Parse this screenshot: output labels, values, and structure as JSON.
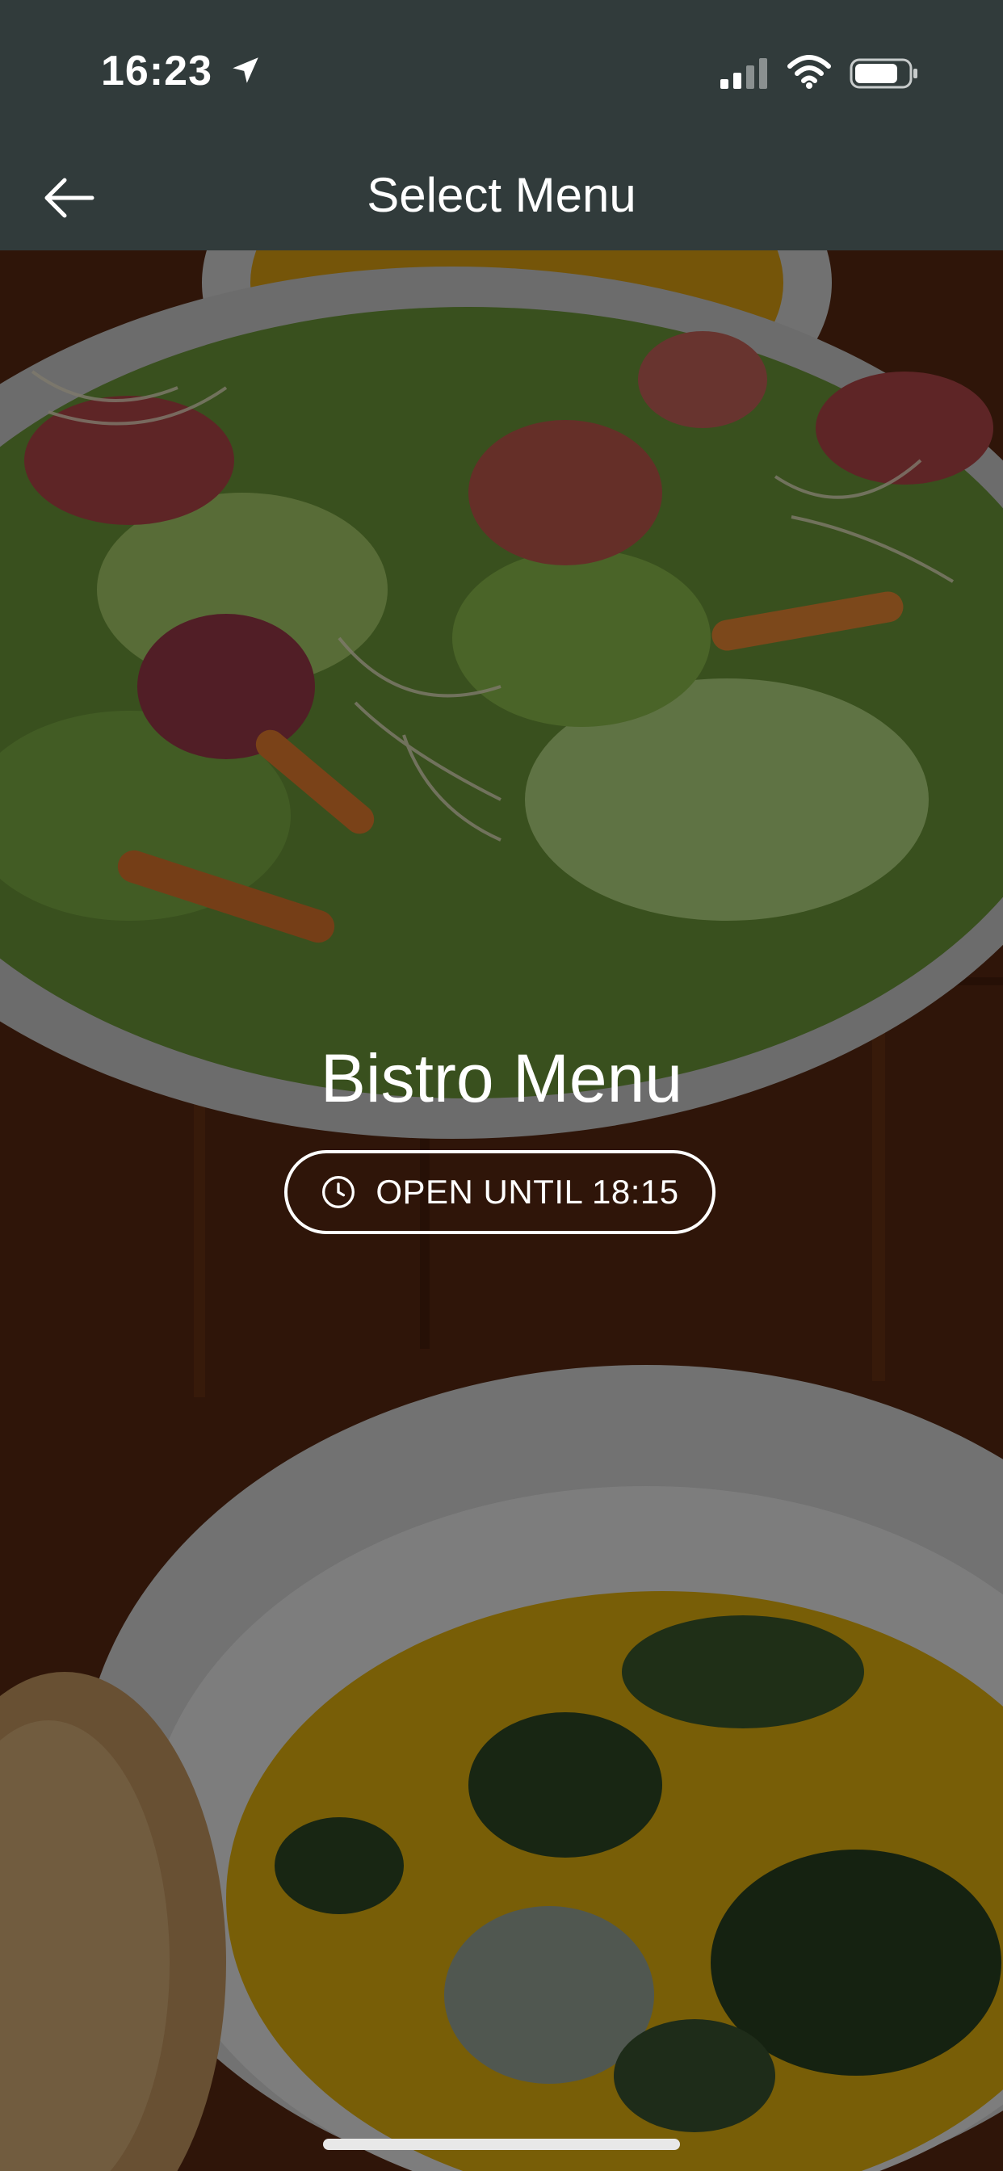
{
  "status_bar": {
    "time": "16:23"
  },
  "nav": {
    "title": "Select Menu",
    "back_icon": "arrow-left-icon"
  },
  "menu_card": {
    "title": "Bistro Menu",
    "hours_label": "OPEN UNTIL 18:15",
    "hours_icon": "clock-icon"
  },
  "colors": {
    "header_bg": "#313b3b",
    "text": "#ffffff"
  }
}
